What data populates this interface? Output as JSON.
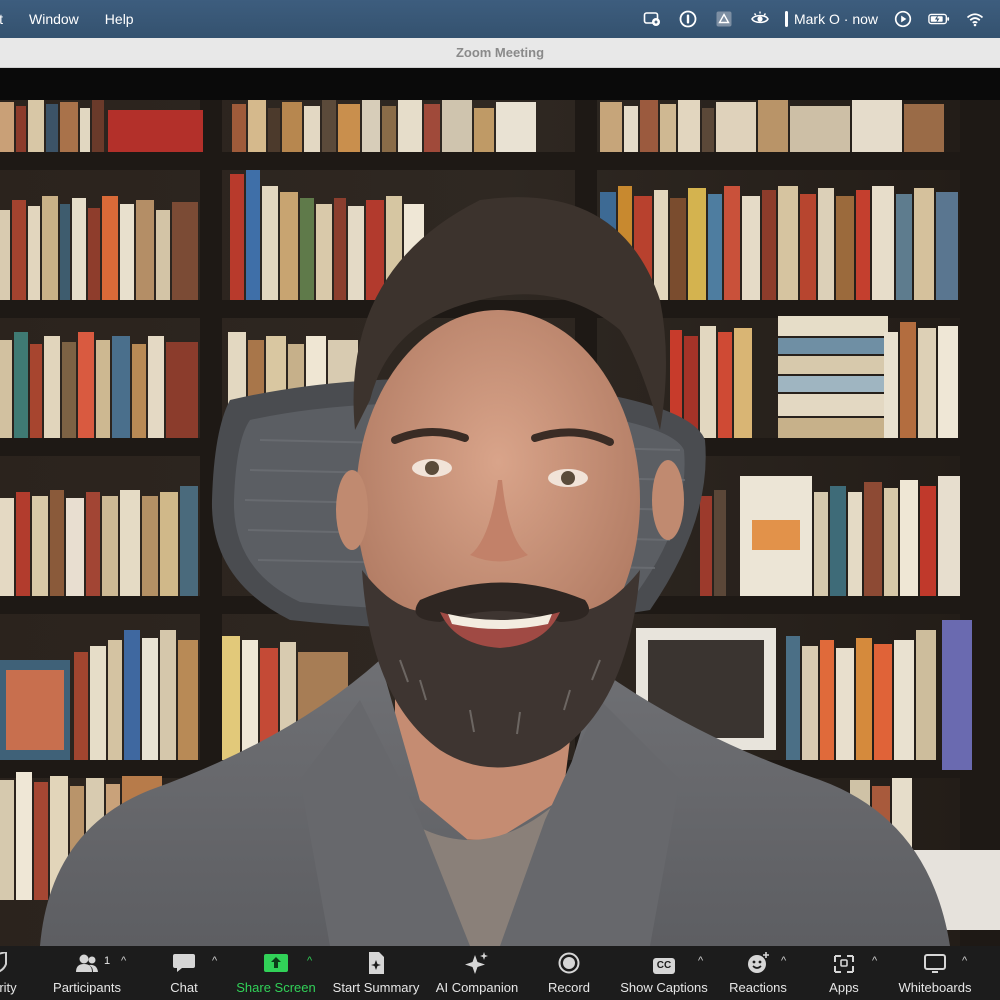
{
  "menubar": {
    "items": [
      "it",
      "Window",
      "Help"
    ],
    "notification_text": "Mark O · now",
    "tray_icons": [
      "screen-share-icon",
      "onepassword-icon",
      "drive-icon",
      "eye-icon",
      "play-circle-icon",
      "battery-charging-icon",
      "wifi-icon"
    ]
  },
  "window": {
    "title": "Zoom Meeting"
  },
  "toolbar": {
    "security_label": "rity",
    "participants_label": "Participants",
    "participants_count": "1",
    "chat_label": "Chat",
    "share_label": "Share Screen",
    "summary_label": "Start Summary",
    "ai_label": "AI Companion",
    "record_label": "Record",
    "captions_label": "Show Captions",
    "captions_icon_text": "CC",
    "reactions_label": "Reactions",
    "apps_label": "Apps",
    "whiteboards_label": "Whiteboards",
    "caret": "^"
  },
  "colors": {
    "menubar": "#3a5a7a",
    "toolbar": "#1c1c1c",
    "share_green": "#31d158"
  }
}
